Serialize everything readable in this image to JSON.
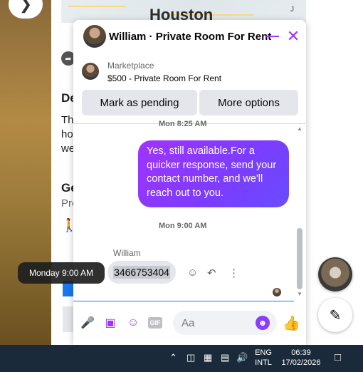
{
  "map": {
    "title": "Houston",
    "corner_label": "J"
  },
  "background": {
    "heading_1": "De",
    "line_1": "Th",
    "line_2": "ho",
    "line_3": "we",
    "heading_2": "Ge",
    "line_4": "Pro"
  },
  "chat": {
    "title": "William · Private Room For Rent",
    "marketplace_label": "Marketplace",
    "listing": "$500 - Private Room For Rent",
    "buttons": {
      "pending": "Mark as pending",
      "more": "More options"
    },
    "timestamp_top": "Mon 8:25 AM",
    "outgoing_message": "Yes, still available.For a quicker response, send your contact number, and we'll reach out to you.",
    "timestamp_mid": "Mon 9:00 AM",
    "sender_name": "William",
    "incoming_message": "3466753404",
    "composer": {
      "placeholder": "Aa"
    },
    "icons": [
      "microphone-icon",
      "photo-icon",
      "sticker-icon",
      "gif-icon",
      "emoji-icon",
      "like-icon"
    ],
    "accent_color": "#a033ff"
  },
  "tooltip": {
    "text": "Monday 9:00 AM"
  },
  "taskbar": {
    "language_top": "ENG",
    "language_bottom": "INTL",
    "time": "06:39",
    "date": "17/02/2026"
  }
}
